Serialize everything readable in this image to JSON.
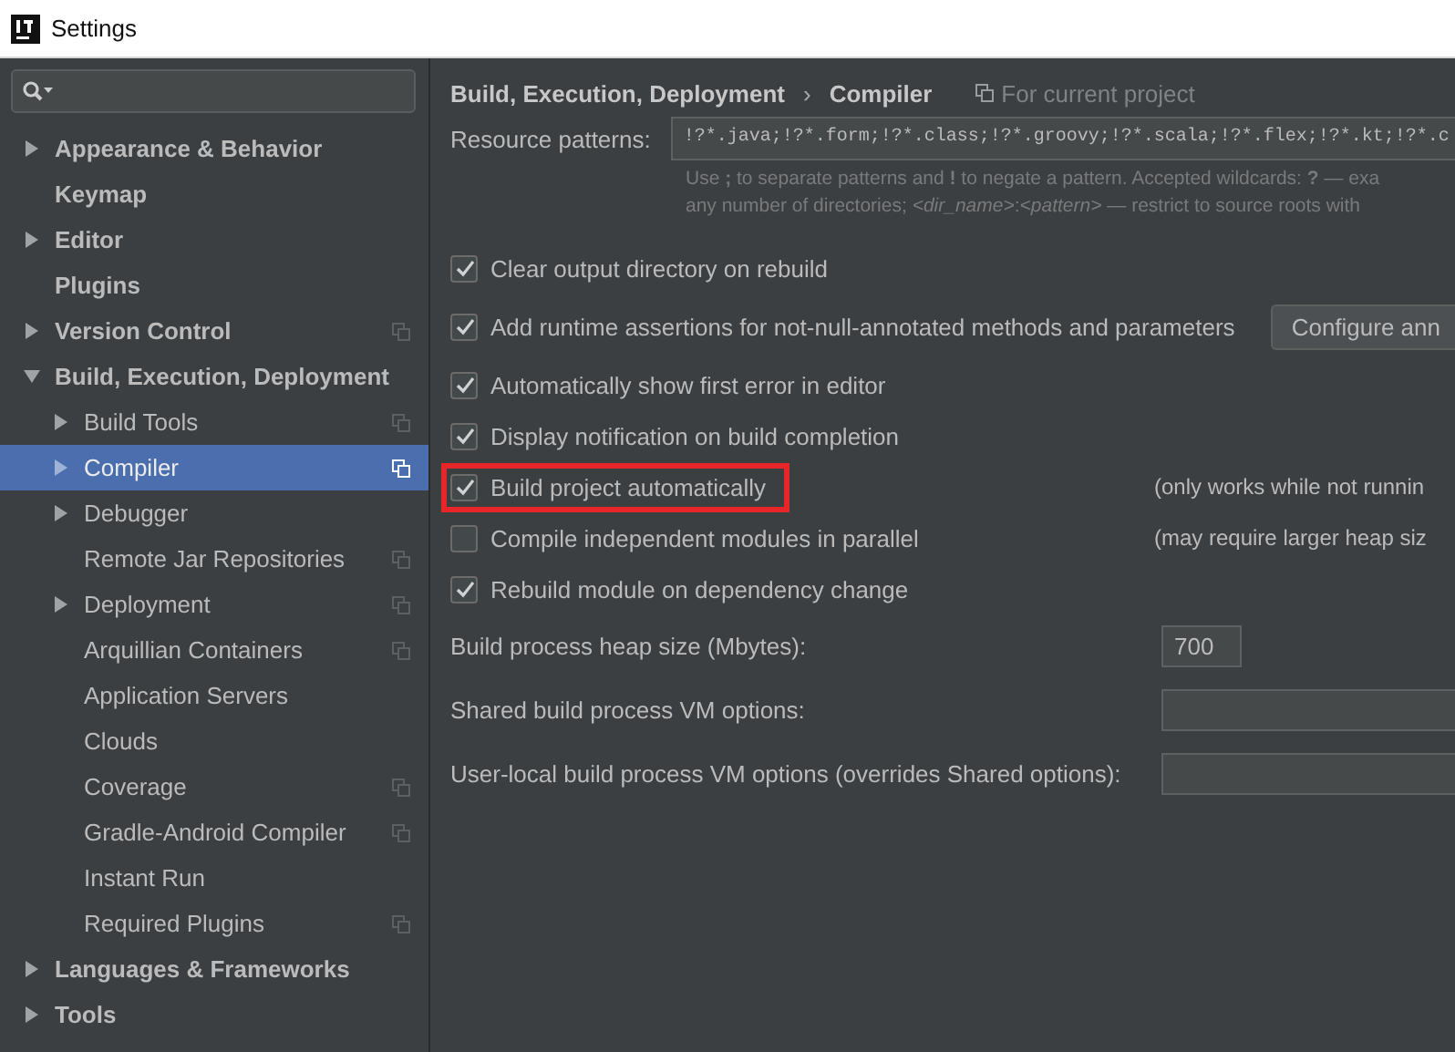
{
  "window": {
    "title": "Settings"
  },
  "sidebar": {
    "items": [
      {
        "label": "Appearance & Behavior",
        "kind": "folder",
        "expanded": false,
        "selected": false,
        "project_scope": false
      },
      {
        "label": "Keymap",
        "kind": "page",
        "selected": false,
        "project_scope": false
      },
      {
        "label": "Editor",
        "kind": "folder",
        "expanded": false,
        "selected": false,
        "project_scope": false
      },
      {
        "label": "Plugins",
        "kind": "page",
        "selected": false,
        "project_scope": false
      },
      {
        "label": "Version Control",
        "kind": "folder",
        "expanded": false,
        "selected": false,
        "project_scope": true
      },
      {
        "label": "Build, Execution, Deployment",
        "kind": "folder",
        "expanded": true,
        "selected": false,
        "project_scope": false,
        "children": [
          {
            "label": "Build Tools",
            "kind": "folder",
            "expanded": false,
            "selected": false,
            "project_scope": true
          },
          {
            "label": "Compiler",
            "kind": "folder",
            "expanded": false,
            "selected": true,
            "project_scope": true
          },
          {
            "label": "Debugger",
            "kind": "folder",
            "expanded": false,
            "selected": false,
            "project_scope": false
          },
          {
            "label": "Remote Jar Repositories",
            "kind": "page",
            "selected": false,
            "project_scope": true
          },
          {
            "label": "Deployment",
            "kind": "folder",
            "expanded": false,
            "selected": false,
            "project_scope": true
          },
          {
            "label": "Arquillian Containers",
            "kind": "page",
            "selected": false,
            "project_scope": true
          },
          {
            "label": "Application Servers",
            "kind": "page",
            "selected": false,
            "project_scope": false
          },
          {
            "label": "Clouds",
            "kind": "page",
            "selected": false,
            "project_scope": false
          },
          {
            "label": "Coverage",
            "kind": "page",
            "selected": false,
            "project_scope": true
          },
          {
            "label": "Gradle-Android Compiler",
            "kind": "page",
            "selected": false,
            "project_scope": true
          },
          {
            "label": "Instant Run",
            "kind": "page",
            "selected": false,
            "project_scope": false
          },
          {
            "label": "Required Plugins",
            "kind": "page",
            "selected": false,
            "project_scope": true
          }
        ]
      },
      {
        "label": "Languages & Frameworks",
        "kind": "folder",
        "expanded": false,
        "selected": false,
        "project_scope": false
      },
      {
        "label": "Tools",
        "kind": "folder",
        "expanded": false,
        "selected": false,
        "project_scope": false
      }
    ]
  },
  "breadcrumb": {
    "parent": "Build, Execution, Deployment",
    "separator": "›",
    "current": "Compiler",
    "scope": "For current project"
  },
  "resource_patterns": {
    "label": "Resource patterns:",
    "value": "!?*.java;!?*.form;!?*.class;!?*.groovy;!?*.scala;!?*.flex;!?*.kt;!?*.c",
    "hint": [
      "Use **;** to separate patterns and **!** to negate a pattern. Accepted wildcards: **?** — exa",
      "any number of directories; *<dir_name>*:*<pattern>* — restrict to source roots with"
    ]
  },
  "options": [
    {
      "label": "Clear output directory on rebuild",
      "checked": true,
      "highlighted": false
    },
    {
      "label": "Add runtime assertions for not-null-annotated methods and parameters",
      "checked": true,
      "highlighted": false,
      "button": "Configure ann"
    },
    {
      "label": "Automatically show first error in editor",
      "checked": true,
      "highlighted": false
    },
    {
      "label": "Display notification on build completion",
      "checked": true,
      "highlighted": false
    },
    {
      "label": "Build project automatically",
      "checked": true,
      "highlighted": true,
      "note": "(only works while not runnin"
    },
    {
      "label": "Compile independent modules in parallel",
      "checked": false,
      "highlighted": false,
      "note": "(may require larger heap siz"
    },
    {
      "label": "Rebuild module on dependency change",
      "checked": true,
      "highlighted": false
    }
  ],
  "fields": [
    {
      "label": "Build process heap size (Mbytes):",
      "value": "700",
      "kind": "short"
    },
    {
      "label": "Shared build process VM options:",
      "kind": "wide"
    },
    {
      "label": "User-local build process VM options (overrides Shared options):",
      "kind": "wide"
    }
  ]
}
